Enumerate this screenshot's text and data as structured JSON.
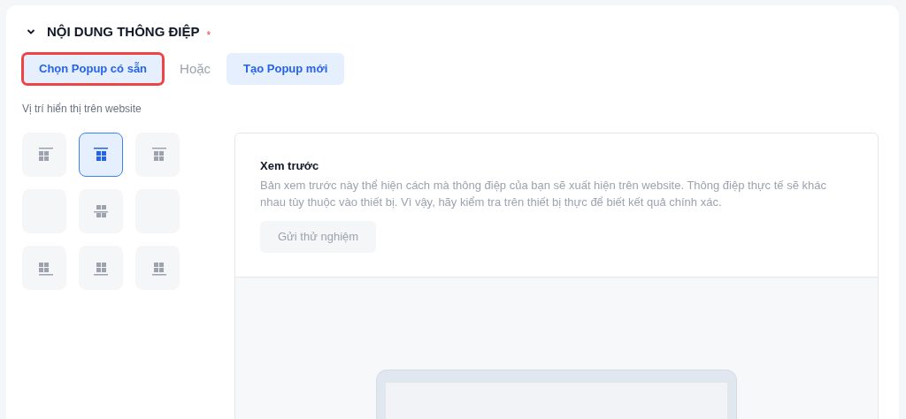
{
  "section": {
    "title": "NỘI DUNG THÔNG ĐIỆP",
    "required_mark": "*",
    "expanded": true
  },
  "source_options": [
    {
      "label": "Chọn Popup có sẵn",
      "highlighted": true
    },
    {
      "label": "Tạo Popup mới",
      "highlighted": false
    }
  ],
  "or_label": "Hoặc",
  "position": {
    "label": "Vị trí hiển thị trên website",
    "options": [
      {
        "kind": "top-left",
        "selected": false
      },
      {
        "kind": "top-center",
        "selected": true
      },
      {
        "kind": "top-right",
        "selected": false
      },
      {
        "kind": "none",
        "selected": false
      },
      {
        "kind": "middle-center",
        "selected": false
      },
      {
        "kind": "none",
        "selected": false
      },
      {
        "kind": "bottom-left",
        "selected": false
      },
      {
        "kind": "bottom-center",
        "selected": false
      },
      {
        "kind": "bottom-right",
        "selected": false
      }
    ]
  },
  "preview": {
    "title": "Xem trước",
    "description": "Bản xem trước này thể hiện cách mà thông điệp của bạn sẽ xuất hiện trên website. Thông điệp thực tế sẽ khác nhau tùy thuộc vào thiết bị. Vì vậy, hãy kiểm tra trên thiết bị thực để biết kết quả chính xác.",
    "test_button": {
      "label": "Gửi thử nghiệm",
      "disabled": true
    }
  }
}
